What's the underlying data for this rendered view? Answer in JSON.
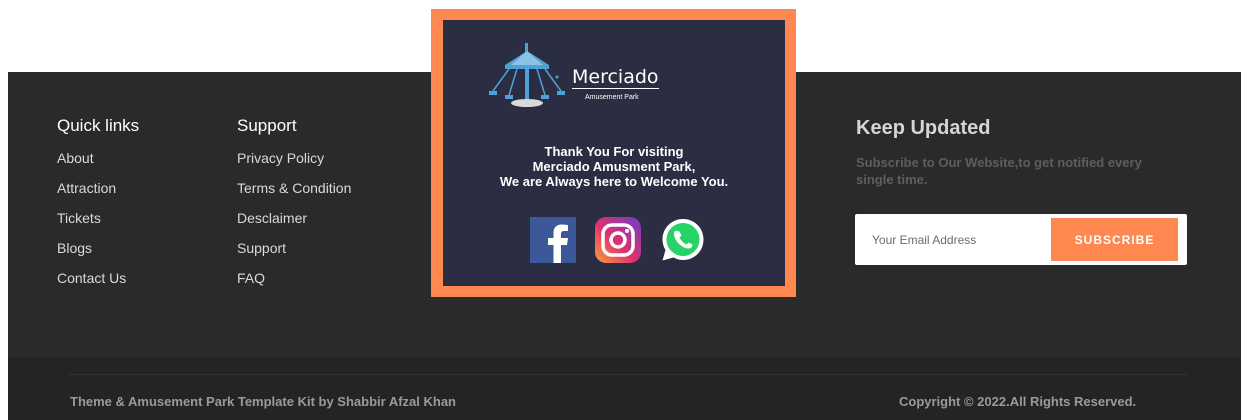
{
  "quick_links": {
    "title": "Quick links",
    "items": [
      "About",
      "Attraction",
      "Tickets",
      "Blogs",
      "Contact Us"
    ]
  },
  "support": {
    "title": "Support",
    "items": [
      "Privacy Policy",
      "Terms & Condition",
      "Desclaimer",
      "Support",
      "FAQ"
    ]
  },
  "newsletter": {
    "title": "Keep Updated",
    "description": "Subscribe to Our Website,to get notified every single time.",
    "email_placeholder": "Your Email Address",
    "email_value": "",
    "button_label": "SUBSCRIBE"
  },
  "modal": {
    "logo_name": "Merciado",
    "logo_tagline": "Amusement Park",
    "message_lines": [
      "Thank You For visiting",
      "Merciado Amusment Park,",
      "We are Always here to Welcome You."
    ],
    "social_icons": [
      "facebook-icon",
      "instagram-icon",
      "whatsapp-icon"
    ]
  },
  "footer_bottom": {
    "credit": "Theme & Amusement Park Template Kit by Shabbir Afzal Khan",
    "copyright": "Copyright © 2022.All Rights Reserved."
  },
  "colors": {
    "accent": "#ff8750",
    "footer_bg": "#2b2a2a",
    "modal_bg": "#2b2d42",
    "facebook": "#3b5998",
    "whatsapp": "#25d366"
  }
}
